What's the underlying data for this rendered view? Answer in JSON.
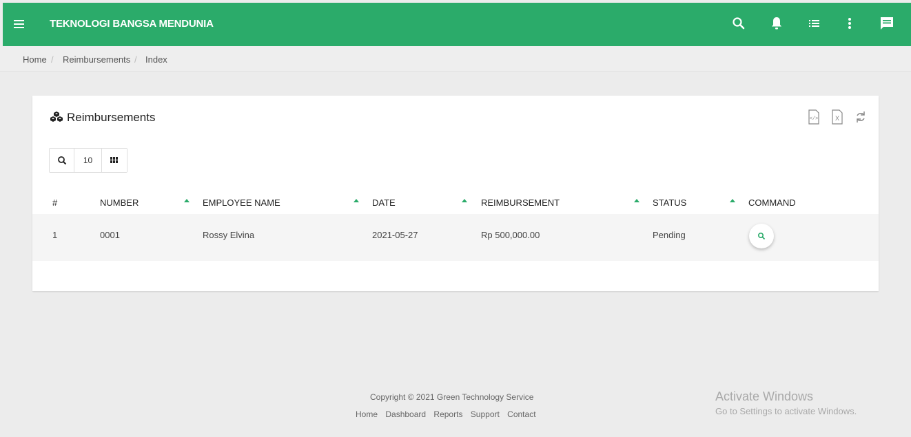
{
  "header": {
    "brand": "TEKNOLOGI BANGSA MENDUNIA",
    "icons": [
      "menu-icon",
      "search-icon",
      "bell-icon",
      "list-icon",
      "more-vert-icon",
      "chat-icon"
    ],
    "bg_color": "#2bab6a"
  },
  "breadcrumb": {
    "items": [
      "Home",
      "Reimbursements",
      "Index"
    ],
    "separator": "/"
  },
  "card": {
    "title": "Reimbursements",
    "title_icon": "cubes-icon",
    "tools": [
      "export-html-icon",
      "export-excel-icon",
      "refresh-icon"
    ],
    "toolbar": {
      "search_icon": "search-icon",
      "page_size": "10",
      "columns_icon": "columns-icon"
    }
  },
  "table": {
    "columns": [
      "#",
      "NUMBER",
      "EMPLOYEE NAME",
      "DATE",
      "REIMBURSEMENT",
      "STATUS",
      "COMMAND"
    ],
    "rows": [
      {
        "no": "1",
        "number": "0001",
        "employee": "Rossy Elvina",
        "date": "2021-05-27",
        "amount": "Rp 500,000.00",
        "status": "Pending"
      }
    ],
    "sort_color": "#2bab6a"
  },
  "footer": {
    "copyright": "Copyright © 2021 Green Technology Service",
    "links": [
      "Home",
      "Dashboard",
      "Reports",
      "Support",
      "Contact"
    ]
  },
  "watermark": {
    "line1": "Activate Windows",
    "line2": "Go to Settings to activate Windows."
  }
}
